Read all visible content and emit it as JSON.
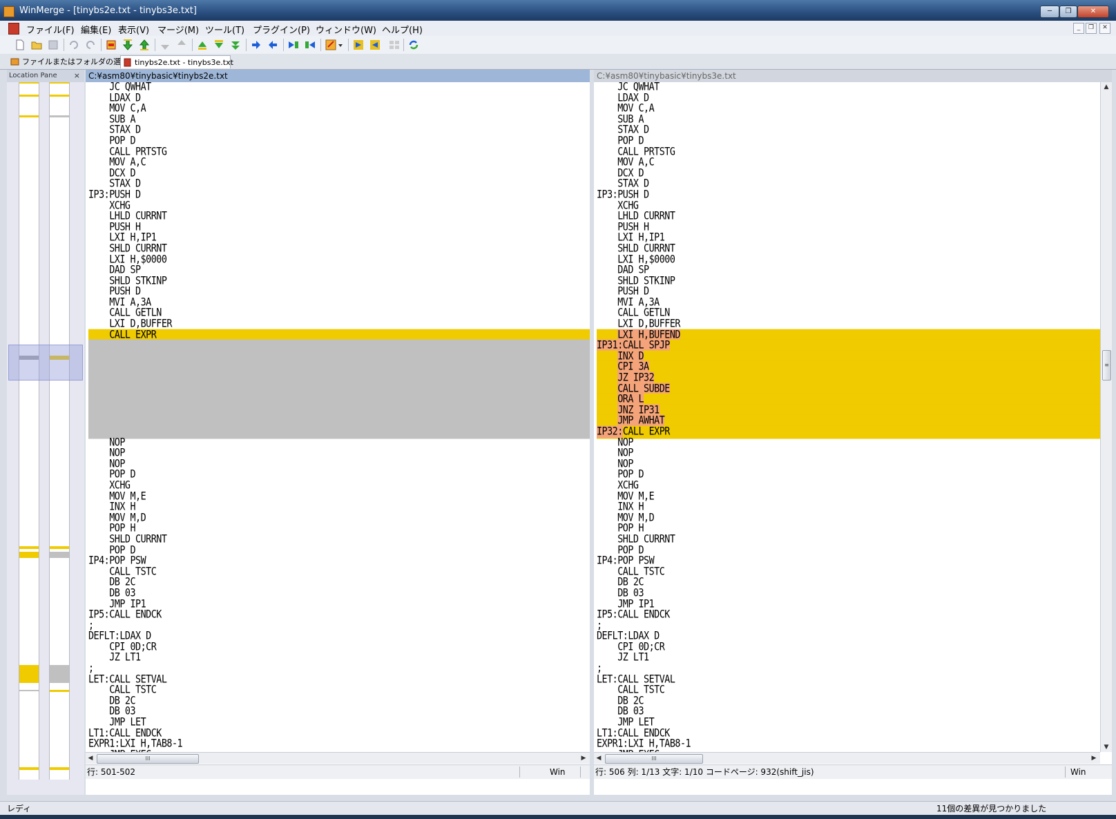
{
  "window": {
    "title": "WinMerge - [tinybs2e.txt - tinybs3e.txt]",
    "controls": {
      "minimize": "─",
      "maximize": "❐",
      "close": "✕"
    }
  },
  "menu": {
    "items": [
      "ファイル(F)",
      "編集(E)",
      "表示(V)",
      "マージ(M)",
      "ツール(T)",
      "プラグイン(P)",
      "ウィンドウ(W)",
      "ヘルプ(H)"
    ],
    "mdi_controls": {
      "minimize": "_",
      "restore": "❐",
      "close": "✕"
    }
  },
  "toolbar": {
    "buttons": [
      "new-icon",
      "open-icon",
      "save-icon",
      "undo-icon",
      "redo-icon",
      "diff-prev-icon",
      "diff-first-icon",
      "diff-next-icon",
      "diff-last-icon",
      "current-diff-icon",
      "copy-right-advance-icon",
      "copy-left-advance-icon",
      "copy-right-icon",
      "copy-left-icon",
      "copy-right-all-icon",
      "copy-left-all-icon",
      "options-icon",
      "dropdown-icon",
      "goto-icon",
      "back-icon",
      "tile-icon",
      "refresh-icon"
    ]
  },
  "tabs": [
    {
      "label": "ファイルまたはフォルダの選択...",
      "active": false
    },
    {
      "label": "tinybs2e.txt - tinybs3e.txt",
      "active": true
    }
  ],
  "location_pane": {
    "title": "Location Pane",
    "close": "×"
  },
  "left_pane": {
    "path": "C:¥asm80¥tinybasic¥tinybs2e.txt",
    "status": {
      "position": "行: 501-502",
      "eol": "Win"
    },
    "scroll_thumb": "III",
    "lines": [
      {
        "t": "    JC QWHAT",
        "k": ""
      },
      {
        "t": "    LDAX D",
        "k": ""
      },
      {
        "t": "    MOV C,A",
        "k": ""
      },
      {
        "t": "    SUB A",
        "k": ""
      },
      {
        "t": "    STAX D",
        "k": ""
      },
      {
        "t": "    POP D",
        "k": ""
      },
      {
        "t": "    CALL PRTSTG",
        "k": ""
      },
      {
        "t": "    MOV A,C",
        "k": ""
      },
      {
        "t": "    DCX D",
        "k": ""
      },
      {
        "t": "    STAX D",
        "k": ""
      },
      {
        "t": "IP3:PUSH D",
        "k": ""
      },
      {
        "t": "    XCHG",
        "k": ""
      },
      {
        "t": "    LHLD CURRNT",
        "k": ""
      },
      {
        "t": "    PUSH H",
        "k": ""
      },
      {
        "t": "    LXI H,IP1",
        "k": ""
      },
      {
        "t": "    SHLD CURRNT",
        "k": ""
      },
      {
        "t": "    LXI H,$0000",
        "k": ""
      },
      {
        "t": "    DAD SP",
        "k": ""
      },
      {
        "t": "    SHLD STKINP",
        "k": ""
      },
      {
        "t": "    PUSH D",
        "k": ""
      },
      {
        "t": "    MVI A,3A",
        "k": ""
      },
      {
        "t": "    CALL GETLN",
        "k": ""
      },
      {
        "t": "    LXI D,BUFFER",
        "k": ""
      },
      {
        "t": "    CALL EXPR",
        "k": "diff"
      },
      {
        "t": "",
        "k": "blank"
      },
      {
        "t": "",
        "k": "blank"
      },
      {
        "t": "",
        "k": "blank"
      },
      {
        "t": "",
        "k": "blank"
      },
      {
        "t": "",
        "k": "blank"
      },
      {
        "t": "",
        "k": "blank"
      },
      {
        "t": "",
        "k": "blank"
      },
      {
        "t": "",
        "k": "blank"
      },
      {
        "t": "",
        "k": "blank"
      },
      {
        "t": "    NOP",
        "k": ""
      },
      {
        "t": "    NOP",
        "k": ""
      },
      {
        "t": "    NOP",
        "k": ""
      },
      {
        "t": "    POP D",
        "k": ""
      },
      {
        "t": "    XCHG",
        "k": ""
      },
      {
        "t": "    MOV M,E",
        "k": ""
      },
      {
        "t": "    INX H",
        "k": ""
      },
      {
        "t": "    MOV M,D",
        "k": ""
      },
      {
        "t": "    POP H",
        "k": ""
      },
      {
        "t": "    SHLD CURRNT",
        "k": ""
      },
      {
        "t": "    POP D",
        "k": ""
      },
      {
        "t": "IP4:POP PSW",
        "k": ""
      },
      {
        "t": "    CALL TSTC",
        "k": ""
      },
      {
        "t": "    DB 2C",
        "k": ""
      },
      {
        "t": "    DB 03",
        "k": ""
      },
      {
        "t": "    JMP IP1",
        "k": ""
      },
      {
        "t": "IP5:CALL ENDCK",
        "k": ""
      },
      {
        "t": ";",
        "k": ""
      },
      {
        "t": "DEFLT:LDAX D",
        "k": ""
      },
      {
        "t": "    CPI 0D;CR",
        "k": ""
      },
      {
        "t": "    JZ LT1",
        "k": ""
      },
      {
        "t": ";",
        "k": ""
      },
      {
        "t": "LET:CALL SETVAL",
        "k": ""
      },
      {
        "t": "    CALL TSTC",
        "k": ""
      },
      {
        "t": "    DB 2C",
        "k": ""
      },
      {
        "t": "    DB 03",
        "k": ""
      },
      {
        "t": "    JMP LET",
        "k": ""
      },
      {
        "t": "LT1:CALL ENDCK",
        "k": ""
      },
      {
        "t": "EXPR1:LXI H,TAB8-1",
        "k": ""
      },
      {
        "t": "    JMP EXEC",
        "k": ""
      }
    ]
  },
  "right_pane": {
    "path": "C:¥asm80¥tinybasic¥tinybs3e.txt",
    "status": {
      "position": "行: 506  列: 1/13  文字: 1/10  コードページ: 932(shift_jis)",
      "eol": "Win"
    },
    "scroll_thumb": "III",
    "lines": [
      {
        "t": "    JC QWHAT",
        "k": ""
      },
      {
        "t": "    LDAX D",
        "k": ""
      },
      {
        "t": "    MOV C,A",
        "k": ""
      },
      {
        "t": "    SUB A",
        "k": ""
      },
      {
        "t": "    STAX D",
        "k": ""
      },
      {
        "t": "    POP D",
        "k": ""
      },
      {
        "t": "    CALL PRTSTG",
        "k": ""
      },
      {
        "t": "    MOV A,C",
        "k": ""
      },
      {
        "t": "    DCX D",
        "k": ""
      },
      {
        "t": "    STAX D",
        "k": ""
      },
      {
        "t": "IP3:PUSH D",
        "k": ""
      },
      {
        "t": "    XCHG",
        "k": ""
      },
      {
        "t": "    LHLD CURRNT",
        "k": ""
      },
      {
        "t": "    PUSH H",
        "k": ""
      },
      {
        "t": "    LXI H,IP1",
        "k": ""
      },
      {
        "t": "    SHLD CURRNT",
        "k": ""
      },
      {
        "t": "    LXI H,$0000",
        "k": ""
      },
      {
        "t": "    DAD SP",
        "k": ""
      },
      {
        "t": "    SHLD STKINP",
        "k": ""
      },
      {
        "t": "    PUSH D",
        "k": ""
      },
      {
        "t": "    MVI A,3A",
        "k": ""
      },
      {
        "t": "    CALL GETLN",
        "k": ""
      },
      {
        "t": "    LXI D,BUFFER",
        "k": ""
      },
      {
        "t": "    ",
        "k": "diff",
        "w": "LXI H,BUFEND"
      },
      {
        "t": "",
        "k": "diff",
        "w": "IP31:CALL SPJP"
      },
      {
        "t": "    ",
        "k": "diff",
        "w": "INX D"
      },
      {
        "t": "    ",
        "k": "diff",
        "w": "CPI 3A"
      },
      {
        "t": "    ",
        "k": "diff",
        "w": "JZ IP32"
      },
      {
        "t": "    ",
        "k": "diff",
        "w": "CALL SUBDE"
      },
      {
        "t": "    ",
        "k": "diff",
        "w": "ORA L"
      },
      {
        "t": "    ",
        "k": "diff",
        "w": "JNZ IP31"
      },
      {
        "t": "    ",
        "k": "diff",
        "w": "JMP AWHAT"
      },
      {
        "t": "",
        "k": "diff",
        "w": "IP32:",
        "r": "CALL EXPR"
      },
      {
        "t": "    NOP",
        "k": ""
      },
      {
        "t": "    NOP",
        "k": ""
      },
      {
        "t": "    NOP",
        "k": ""
      },
      {
        "t": "    POP D",
        "k": ""
      },
      {
        "t": "    XCHG",
        "k": ""
      },
      {
        "t": "    MOV M,E",
        "k": ""
      },
      {
        "t": "    INX H",
        "k": ""
      },
      {
        "t": "    MOV M,D",
        "k": ""
      },
      {
        "t": "    POP H",
        "k": ""
      },
      {
        "t": "    SHLD CURRNT",
        "k": ""
      },
      {
        "t": "    POP D",
        "k": ""
      },
      {
        "t": "IP4:POP PSW",
        "k": ""
      },
      {
        "t": "    CALL TSTC",
        "k": ""
      },
      {
        "t": "    DB 2C",
        "k": ""
      },
      {
        "t": "    DB 03",
        "k": ""
      },
      {
        "t": "    JMP IP1",
        "k": ""
      },
      {
        "t": "IP5:CALL ENDCK",
        "k": ""
      },
      {
        "t": ";",
        "k": ""
      },
      {
        "t": "DEFLT:LDAX D",
        "k": ""
      },
      {
        "t": "    CPI 0D;CR",
        "k": ""
      },
      {
        "t": "    JZ LT1",
        "k": ""
      },
      {
        "t": ";",
        "k": ""
      },
      {
        "t": "LET:CALL SETVAL",
        "k": ""
      },
      {
        "t": "    CALL TSTC",
        "k": ""
      },
      {
        "t": "    DB 2C",
        "k": ""
      },
      {
        "t": "    DB 03",
        "k": ""
      },
      {
        "t": "    JMP LET",
        "k": ""
      },
      {
        "t": "LT1:CALL ENDCK",
        "k": ""
      },
      {
        "t": "EXPR1:LXI H,TAB8-1",
        "k": ""
      },
      {
        "t": "    JMP EXEC",
        "k": ""
      }
    ]
  },
  "app_status": {
    "left": "レディ",
    "right": "11個の差異が見つかりました"
  },
  "colors": {
    "diff": "#efcb00",
    "blank": "#c0c0c0",
    "word_diff": "#f4a37a",
    "location_view": "#9aa0dc"
  }
}
